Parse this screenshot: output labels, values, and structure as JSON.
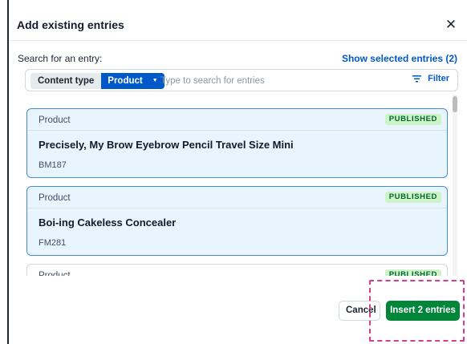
{
  "dialog": {
    "title": "Add existing entries",
    "close_icon": "close-icon",
    "search_label": "Search for an entry:",
    "show_selected": "Show selected entries (2)"
  },
  "search": {
    "content_type_label": "Content type",
    "content_type_value": "Product",
    "placeholder": "Type to search for entries",
    "filter_label": "Filter",
    "filter_icon": "filter-lines-icon"
  },
  "entries": [
    {
      "type": "Product",
      "status": "PUBLISHED",
      "title": "Precisely, My Brow Eyebrow Pencil Travel Size Mini",
      "subtitle": "BM187",
      "selected": true
    },
    {
      "type": "Product",
      "status": "PUBLISHED",
      "title": "Boi-ing Cakeless Concealer",
      "subtitle": "FM281",
      "selected": true
    },
    {
      "type": "Product",
      "status": "PUBLISHED",
      "title": "",
      "subtitle": "",
      "selected": false
    }
  ],
  "footer": {
    "cancel_label": "Cancel",
    "insert_label": "Insert 2 entries"
  },
  "colors": {
    "accent": "#0059c8",
    "primary_button": "#008539",
    "selected_card_bg": "#e8f5ff",
    "status_badge_bg": "#cdf3c6",
    "highlight": "#d63c8a"
  }
}
